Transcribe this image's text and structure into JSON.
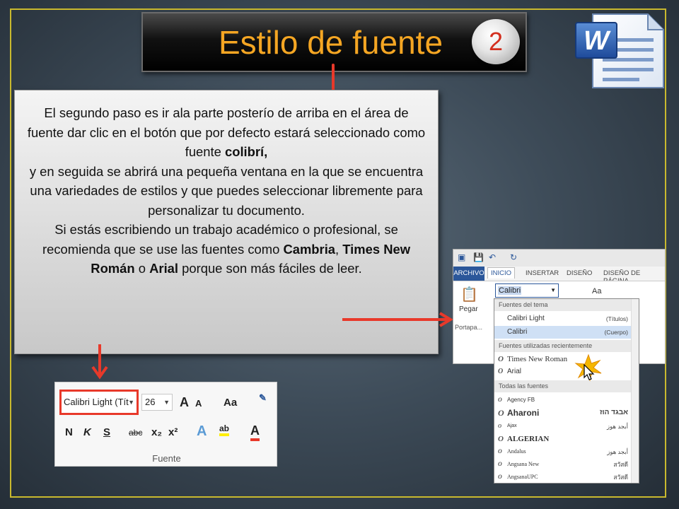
{
  "slide": {
    "title": "Estilo de fuente",
    "badge_number": "2",
    "paragraphs": [
      "El segundo paso es ir ala parte posterío de arriba en el área de fuente dar clic en el botón que por defecto estará seleccionado como fuente",
      "colibrí,",
      "y en seguida se abrirá una pequeña ventana en la que se encuentra una variedades de estilos y que puedes seleccionar libremente para personalizar tu documento.",
      "Si estás escribiendo un trabajo académico o profesional, se recomienda que se use las fuentes como",
      "Cambria",
      "Times New Román",
      "o",
      "Arial",
      "porque son más fáciles de leer."
    ],
    "icon_letter": "W"
  },
  "fuente_group": {
    "font_box": "Calibri Light (Títulos)",
    "font_box_visible": "Calibri Light (Tít",
    "size_box": "26",
    "grow": "A",
    "shrink": "A",
    "case": "Aa",
    "bold": "N",
    "italic": "K",
    "underline": "S",
    "strike": "abc",
    "sub": "x₂",
    "sup": "x²",
    "effects": "A",
    "highlight": "ab",
    "color": "A",
    "label": "Fuente"
  },
  "word_ui": {
    "tabs": [
      "ARCHIVO",
      "INICIO",
      "INSERTAR",
      "DISEÑO",
      "DISEÑO DE PÁGINA"
    ],
    "font_input": "Calibri",
    "paste_label": "Pegar",
    "clipboard_label": "Portapa...",
    "size_label": "Aa",
    "dropdown": {
      "theme_header": "Fuentes del tema",
      "theme_fonts": [
        {
          "name": "Calibri Light",
          "role": "(Títulos)"
        },
        {
          "name": "Calibri",
          "role": "(Cuerpo)"
        }
      ],
      "recent_header": "Fuentes utilizadas recientemente",
      "recent_fonts": [
        "Times New Roman",
        "Arial"
      ],
      "all_header": "Todas las fuentes",
      "all_fonts": [
        {
          "name": "Agency FB",
          "sample": ""
        },
        {
          "name": "Aharoni",
          "sample": "אבגד הוז"
        },
        {
          "name": "Ajax",
          "sample": "أبجد هوز"
        },
        {
          "name": "ALGERIAN",
          "sample": ""
        },
        {
          "name": "Andalus",
          "sample": "أبجد هوز"
        },
        {
          "name": "Angsana New",
          "sample": "สวัสดี"
        },
        {
          "name": "AngsanaUPC",
          "sample": "สวัสดี"
        }
      ]
    }
  }
}
